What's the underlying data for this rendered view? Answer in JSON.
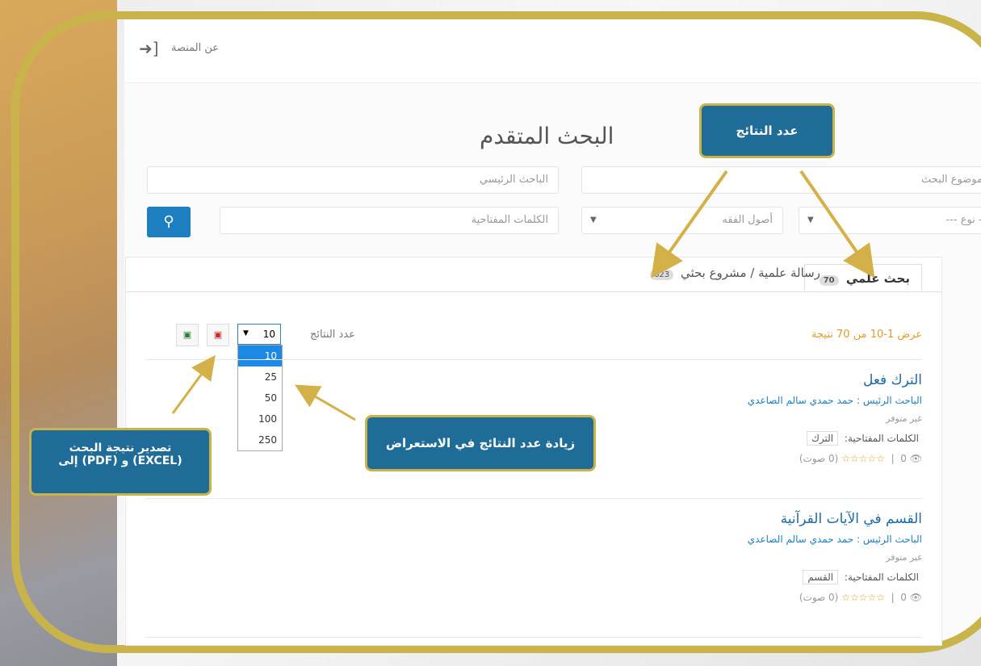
{
  "header": {
    "about_label": "عن المنصة"
  },
  "page": {
    "title": "البحث المتقدم"
  },
  "form": {
    "topic_placeholder": "موضوع البحث",
    "researcher_placeholder": "الباحث الرئيسي",
    "type_value": "--- نوع ---",
    "dept_value": "أصول الفقه",
    "keywords_placeholder": "الكلمات المفتاحية"
  },
  "tabs": [
    {
      "label": "بحث علمي",
      "count": "70"
    },
    {
      "label": "رسالة علمية / مشروع بحثي",
      "count": "623"
    }
  ],
  "results": {
    "summary": "عرض 1-10 من 70 نتيجة",
    "per_page_label": "عدد النتائج",
    "per_page_value": "10",
    "per_page_options": [
      "10",
      "25",
      "50",
      "100",
      "250"
    ]
  },
  "items": [
    {
      "title": "الترك فعل",
      "researcher": "الباحث الرئيس : حمد حمدي سالم الصاعدي",
      "availability": "غير متوفر",
      "keywords_label": "الكلمات المفتاحية:",
      "keyword": "الترك",
      "rating_text": "(0 صوت)",
      "views": "0"
    },
    {
      "title": "القسم في الآيات القرآنية",
      "researcher": "الباحث الرئيس : حمد حمدي سالم الصاعدي",
      "availability": "غير متوفر",
      "keywords_label": "الكلمات المفتاحية:",
      "keyword": "القسم",
      "rating_text": "(0 صوت)",
      "views": "0"
    }
  ],
  "callouts": {
    "count": "عدد النتائج",
    "increase": "زيادة عدد النتائج في الاستعراض",
    "export_line1": "تصدير نتيجة البحث",
    "export_line2": "إلى (PDF) و (EXCEL)"
  },
  "colors": {
    "accent": "#1d7fc0",
    "callout": "#1f6c99",
    "frame": "#c9b44c",
    "summary": "#e29b2a"
  }
}
